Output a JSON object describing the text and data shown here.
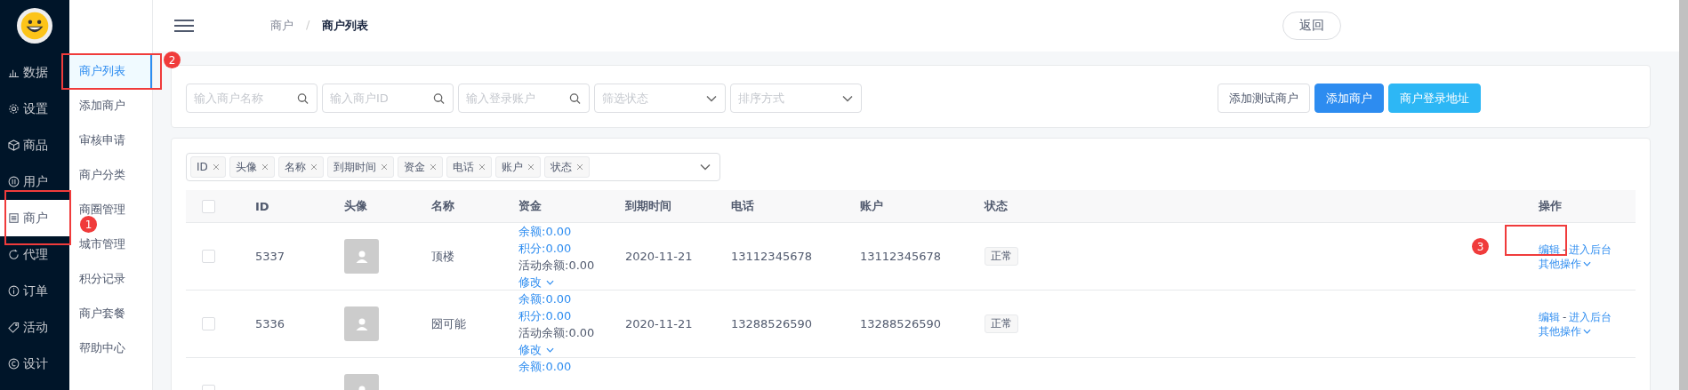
{
  "nav": {
    "items": [
      {
        "label": "数据",
        "selected": false
      },
      {
        "label": "设置",
        "selected": false
      },
      {
        "label": "商品",
        "selected": false
      },
      {
        "label": "用户",
        "selected": false
      },
      {
        "label": "商户",
        "selected": true
      },
      {
        "label": "代理",
        "selected": false
      },
      {
        "label": "订单",
        "selected": false
      },
      {
        "label": "活动",
        "selected": false
      },
      {
        "label": "设计",
        "selected": false
      }
    ]
  },
  "submenu": {
    "items": [
      {
        "label": "商户列表",
        "selected": true
      },
      {
        "label": "添加商户",
        "selected": false
      },
      {
        "label": "审核申请",
        "selected": false
      },
      {
        "label": "商户分类",
        "selected": false
      },
      {
        "label": "商圈管理",
        "selected": false
      },
      {
        "label": "城市管理",
        "selected": false
      },
      {
        "label": "积分记录",
        "selected": false
      },
      {
        "label": "商户套餐",
        "selected": false
      },
      {
        "label": "帮助中心",
        "selected": false
      }
    ]
  },
  "header": {
    "breadcrumb": [
      "商户",
      "商户列表"
    ],
    "separator": "/",
    "back_button": "返回"
  },
  "filters": [
    {
      "kind": "search",
      "placeholder": "输入商户名称"
    },
    {
      "kind": "search",
      "placeholder": "输入商户ID"
    },
    {
      "kind": "search",
      "placeholder": "输入登录账户"
    },
    {
      "kind": "select",
      "placeholder": "筛选状态"
    },
    {
      "kind": "select",
      "placeholder": "排序方式"
    }
  ],
  "actions": [
    {
      "label": "添加测试商户",
      "kind": "default"
    },
    {
      "label": "添加商户",
      "kind": "primary"
    },
    {
      "label": "商户登录地址",
      "kind": "info"
    }
  ],
  "column_picker": {
    "tags": [
      "ID",
      "头像",
      "名称",
      "到期时间",
      "资金",
      "电话",
      "账户",
      "状态"
    ]
  },
  "table": {
    "header_checked": false,
    "columns": [
      "ID",
      "头像",
      "名称",
      "资金",
      "到期时间",
      "电话",
      "账户",
      "状态",
      "操作"
    ],
    "rows": [
      {
        "checked": false,
        "id": "5337",
        "name": "顶楼",
        "funds": [
          {
            "text": "余额:0.00",
            "kind": "link"
          },
          {
            "text": "积分:0.00",
            "kind": "link"
          },
          {
            "text": "活动余额:0.00",
            "kind": "plain"
          },
          {
            "text": "修改",
            "kind": "dropdown"
          }
        ],
        "expiry": "2020-11-21",
        "phone": "13112345678",
        "account": "13112345678",
        "status": "正常",
        "edit": "编辑",
        "dash": "-",
        "enter": "进入后台",
        "more": "其他操作"
      },
      {
        "checked": false,
        "id": "5336",
        "name": "圀可能",
        "funds": [
          {
            "text": "余额:0.00",
            "kind": "link"
          },
          {
            "text": "积分:0.00",
            "kind": "link"
          },
          {
            "text": "活动余额:0.00",
            "kind": "plain"
          },
          {
            "text": "修改",
            "kind": "dropdown"
          }
        ],
        "expiry": "2020-11-21",
        "phone": "13288526590",
        "account": "13288526590",
        "status": "正常",
        "edit": "编辑",
        "dash": "-",
        "enter": "进入后台",
        "more": "其他操作"
      },
      {
        "checked": false,
        "funds": [
          {
            "text": "余额:0.00",
            "kind": "link"
          }
        ]
      }
    ]
  },
  "annotations": [
    {
      "number": "1"
    },
    {
      "number": "2"
    },
    {
      "number": "3"
    }
  ]
}
